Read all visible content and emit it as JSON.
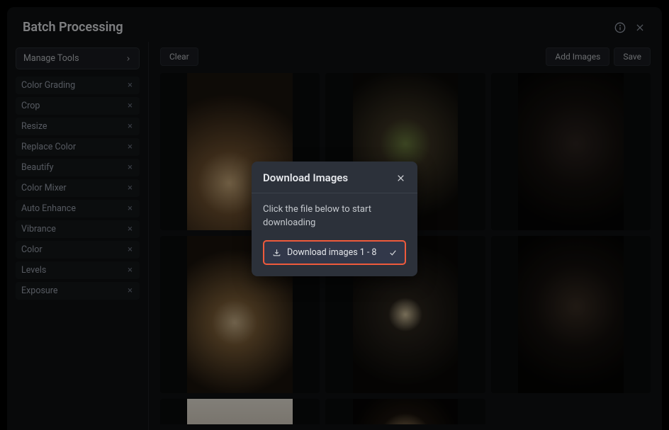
{
  "header": {
    "title": "Batch Processing"
  },
  "sidebar": {
    "manage_label": "Manage Tools",
    "tools": [
      "Color Grading",
      "Crop",
      "Resize",
      "Replace Color",
      "Beautify",
      "Color Mixer",
      "Auto Enhance",
      "Vibrance",
      "Color",
      "Levels",
      "Exposure"
    ]
  },
  "toolbar": {
    "clear": "Clear",
    "add_images": "Add Images",
    "save": "Save"
  },
  "modal": {
    "title": "Download Images",
    "text": "Click the file below to start downloading",
    "download_label": "Download images 1 - 8"
  }
}
